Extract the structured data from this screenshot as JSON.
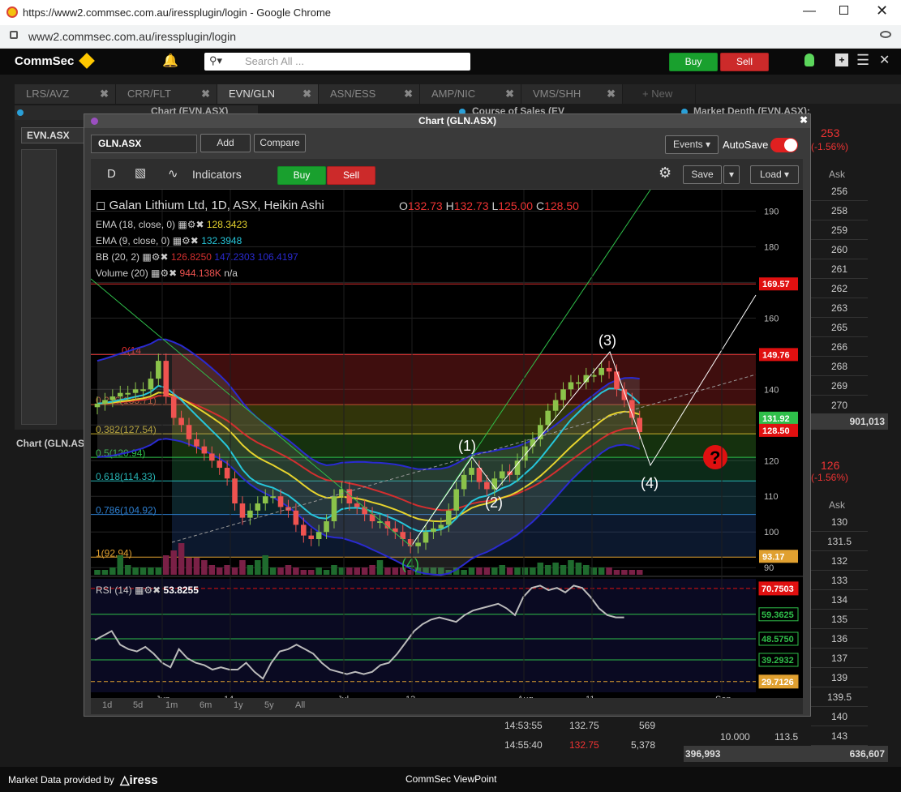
{
  "browser": {
    "title": "https://www2.commsec.com.au/iressplugin/login - Google Chrome",
    "url": "www2.commsec.com.au/iressplugin/login"
  },
  "appbar": {
    "brand": "CommSec",
    "search_placeholder": "Search All ...",
    "buy_label": "Buy",
    "sell_label": "Sell"
  },
  "tabs": [
    {
      "label": "LRS/AVZ"
    },
    {
      "label": "CRR/FLT"
    },
    {
      "label": "EVN/GLN"
    },
    {
      "label": "ASN/ESS"
    },
    {
      "label": "AMP/NIC"
    },
    {
      "label": "VMS/SHH"
    },
    {
      "label": "+ New"
    }
  ],
  "panels": {
    "left_title": "Chart (EVN.ASX)",
    "left_code": "EVN.ASX",
    "left_tab_label": "Chart (GLN.AS",
    "sales_title": "Course of Sales (EV",
    "depth_title": "Market Depth (EVN.ASX):"
  },
  "depth": {
    "price": "253",
    "change": "(-1.56%)",
    "ask_header": "Ask",
    "asks": [
      "256",
      "258",
      "259",
      "260",
      "261",
      "262",
      "263",
      "265",
      "266",
      "268",
      "269",
      "270"
    ],
    "total": "901,013",
    "price2": "126",
    "change2": "(-1.56%)",
    "ask_header2": "Ask",
    "asks2": [
      "130",
      "131.5",
      "132",
      "133",
      "134",
      "135",
      "136",
      "137",
      "139",
      "139.5",
      "140",
      "143"
    ],
    "bottom_left": "10.000",
    "bottom_mid": "113.5",
    "total2": "636,607",
    "total2_left": "396,993"
  },
  "sales": {
    "rows": [
      {
        "time": "14:53:55",
        "price": "132.75",
        "vol": "569"
      },
      {
        "time": "14:55:40",
        "price": "132.75",
        "vol": "5,378"
      }
    ]
  },
  "chart_window": {
    "title": "Chart (GLN.ASX)",
    "symbol": "GLN.ASX",
    "add_label": "Add",
    "compare_label": "Compare",
    "events_label": "Events",
    "autosave_label": "AutoSave",
    "interval_label": "D",
    "indicators_label": "Indicators",
    "buy_label": "Buy",
    "sell_label": "Sell",
    "save_label": "Save",
    "load_label": "Load",
    "ranges": [
      "1d",
      "5d",
      "1m",
      "6m",
      "1y",
      "5y",
      "All"
    ]
  },
  "legend": {
    "title": "Galan Lithium Ltd, 1D, ASX, Heikin Ashi",
    "o_label": "O",
    "o_value": "132.73",
    "h_label": "H",
    "h_value": "132.73",
    "l_label": "L",
    "l_value": "125.00",
    "c_label": "C",
    "c_value": "128.50",
    "ema18_label": "EMA (18, close, 0)",
    "ema18_value": "128.3423",
    "ema9_label": "EMA (9, close, 0)",
    "ema9_value": "132.3948",
    "bb_label": "BB (20, 2)",
    "bb_v1": "126.8250",
    "bb_v2": "147.2303",
    "bb_v3": "106.4197",
    "vol_label": "Volume (20)",
    "vol_value": "944.138K",
    "vol_na": "n/a",
    "rsi_label": "RSI (14)",
    "rsi_value": "53.8255"
  },
  "fib": [
    {
      "label": "0(149.76)",
      "text": "0(14"
    },
    {
      "label": "0.236(135.71)"
    },
    {
      "label": "0.382(127.54)"
    },
    {
      "label": "0.5(120.94)"
    },
    {
      "label": "0.618(114.33)"
    },
    {
      "label": "0.786(104.92)"
    },
    {
      "label": "1(92.94)"
    }
  ],
  "waves": [
    "(1)",
    "(2)",
    "(3)",
    "(4)",
    "(4)"
  ],
  "price_tags": {
    "t1": "169.57",
    "t2": "149.76",
    "t3": "131.92",
    "t4": "128.50",
    "t5": "93.17"
  },
  "rsi_tags": {
    "r1": "70.7503",
    "r2": "59.3625",
    "r3": "48.5750",
    "r4": "39.2932",
    "r5": "29.7126"
  },
  "x_labels": [
    "Jun",
    "14",
    "Jul",
    "13",
    "Aug",
    "11",
    "Sep"
  ],
  "colors": {
    "up": "#8bc34a",
    "down": "#ef5350",
    "ema18": "#e6d32e",
    "ema9": "#26c6da",
    "bb": "#2a2ad0",
    "ema_red": "#d32f2f",
    "brand": "#ffc800"
  },
  "chart_data": {
    "type": "candlestick",
    "title": "Galan Lithium Ltd, 1D, ASX, Heikin Ashi",
    "y_range": [
      88,
      196
    ],
    "yticks": [
      90,
      100,
      110,
      120,
      130,
      140,
      150,
      160,
      170,
      180,
      190
    ],
    "closes": [
      136,
      137,
      138,
      139,
      139,
      140,
      140,
      143,
      148,
      138,
      132,
      130,
      126,
      124,
      122,
      120,
      118,
      115,
      108,
      104,
      106,
      108,
      110,
      110,
      107,
      106,
      102,
      99,
      98,
      100,
      103,
      110,
      112,
      108,
      107,
      105,
      103,
      103,
      101,
      100,
      98,
      96,
      97,
      100,
      101,
      102,
      106,
      112,
      116,
      118,
      114,
      112,
      115,
      117,
      116,
      120,
      124,
      126,
      130,
      134,
      137,
      140,
      142,
      142,
      144,
      144,
      146,
      145,
      140,
      137,
      132,
      128
    ],
    "rsi_range": [
      25,
      75
    ],
    "rsi": [
      48,
      50,
      52,
      46,
      44,
      43,
      45,
      42,
      38,
      36,
      44,
      40,
      38,
      37,
      35,
      36,
      35,
      35,
      38,
      34,
      31,
      38,
      43,
      44,
      46,
      44,
      42,
      38,
      35,
      34,
      33,
      34,
      33,
      34,
      37,
      38,
      42,
      47,
      52,
      55,
      57,
      58,
      57,
      56,
      59,
      61,
      62,
      63,
      64,
      62,
      59,
      67,
      71,
      72,
      70,
      71,
      69,
      72,
      71,
      67,
      62,
      59,
      58,
      58
    ],
    "volume": [
      2,
      2,
      3,
      8,
      4,
      3,
      3,
      3,
      3,
      8,
      10,
      13,
      7,
      7,
      6,
      4,
      3,
      4,
      3,
      6,
      4,
      6,
      8,
      3,
      3,
      4,
      3,
      2,
      2,
      3,
      2,
      4,
      3,
      3,
      3,
      3,
      4,
      6,
      3,
      3,
      3,
      2,
      3,
      3,
      3,
      3,
      2,
      3,
      2,
      3,
      3,
      3,
      3,
      4,
      3,
      3,
      3,
      3,
      5,
      4,
      5,
      4,
      6,
      5,
      4,
      3,
      3,
      3,
      2,
      2,
      2,
      2
    ]
  },
  "status": {
    "provided_by": "Market Data provided by",
    "provider": "iress",
    "app_name": "CommSec ViewPoint"
  }
}
